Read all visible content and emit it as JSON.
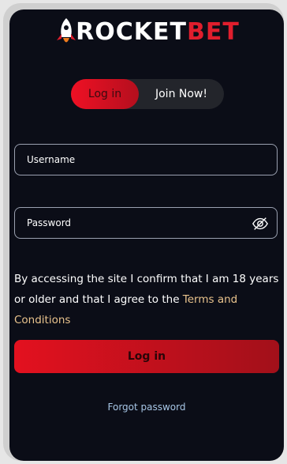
{
  "brand": {
    "logo_part1": "ROCKET",
    "logo_part2": "BET",
    "accent_color": "#e01e2d"
  },
  "auth_toggle": {
    "login_label": "Log in",
    "join_label": "Join Now!",
    "active": "login"
  },
  "form": {
    "username_placeholder": "Username",
    "password_placeholder": "Password",
    "password_visibility_icon": "eye-off-icon"
  },
  "terms": {
    "text": "By accessing the site I confirm that I am 18 years or older and that I agree to the ",
    "link_text": "Terms and Conditions"
  },
  "login_button_label": "Log in",
  "forgot_password_label": "Forgot password"
}
